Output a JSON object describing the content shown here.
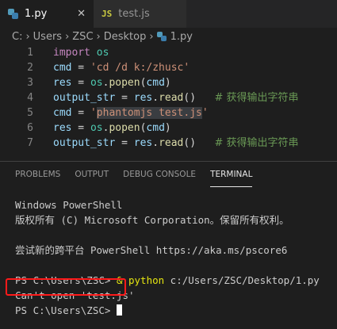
{
  "tabs": [
    {
      "label": "1.py",
      "icon": "python-file-icon",
      "active": true,
      "close": "✕"
    },
    {
      "label": "test.js",
      "icon": "js-file-icon",
      "active": false,
      "icon_text": "JS"
    }
  ],
  "breadcrumb": [
    "C:",
    "Users",
    "ZSC",
    "Desktop",
    "1.py"
  ],
  "code_lines": [
    {
      "n": "1",
      "tokens": [
        [
          "kw",
          "import"
        ],
        [
          "op",
          " "
        ],
        [
          "mod",
          "os"
        ]
      ]
    },
    {
      "n": "2",
      "tokens": [
        [
          "var",
          "cmd"
        ],
        [
          "op",
          " = "
        ],
        [
          "str",
          "'cd /d k:/zhusc'"
        ]
      ]
    },
    {
      "n": "3",
      "tokens": [
        [
          "var",
          "res"
        ],
        [
          "op",
          " = "
        ],
        [
          "mod",
          "os"
        ],
        [
          "op",
          "."
        ],
        [
          "fn",
          "popen"
        ],
        [
          "op",
          "("
        ],
        [
          "var",
          "cmd"
        ],
        [
          "op",
          ")"
        ]
      ]
    },
    {
      "n": "4",
      "tokens": [
        [
          "var",
          "output_str"
        ],
        [
          "op",
          " = "
        ],
        [
          "var",
          "res"
        ],
        [
          "op",
          "."
        ],
        [
          "fn",
          "read"
        ],
        [
          "op",
          "()   "
        ],
        [
          "cm",
          "# 获得输出字符串"
        ]
      ]
    },
    {
      "n": "5",
      "tokens": [
        [
          "var",
          "cmd"
        ],
        [
          "op",
          " = "
        ],
        [
          "str",
          "'"
        ],
        [
          "strhl",
          "phantomjs test.js"
        ],
        [
          "str",
          "'"
        ]
      ]
    },
    {
      "n": "6",
      "tokens": [
        [
          "var",
          "res"
        ],
        [
          "op",
          " = "
        ],
        [
          "mod",
          "os"
        ],
        [
          "op",
          "."
        ],
        [
          "fn",
          "popen"
        ],
        [
          "op",
          "("
        ],
        [
          "var",
          "cmd"
        ],
        [
          "op",
          ")"
        ]
      ]
    },
    {
      "n": "7",
      "tokens": [
        [
          "var",
          "output_str"
        ],
        [
          "op",
          " = "
        ],
        [
          "var",
          "res"
        ],
        [
          "op",
          "."
        ],
        [
          "fn",
          "read"
        ],
        [
          "op",
          "()   "
        ],
        [
          "cm",
          "# 获得输出字符串"
        ]
      ]
    }
  ],
  "panel_tabs": [
    {
      "label": "PROBLEMS",
      "active": false
    },
    {
      "label": "OUTPUT",
      "active": false
    },
    {
      "label": "DEBUG CONSOLE",
      "active": false
    },
    {
      "label": "TERMINAL",
      "active": true
    }
  ],
  "terminal": {
    "line1": "Windows PowerShell",
    "line2": "版权所有 (C) Microsoft Corporation。保留所有权利。",
    "line3": "",
    "line4": "尝试新的跨平台 PowerShell https://aka.ms/pscore6",
    "line5": "",
    "prompt1": "PS C:\\Users\\ZSC> ",
    "cmd_amp": "& ",
    "cmd_exe": "python",
    "cmd_arg": " c:/Users/ZSC/Desktop/1.py",
    "error": "Can't open 'test.js'",
    "prompt2": "PS C:\\Users\\ZSC> "
  },
  "colors": {
    "background": "#1e1e1e",
    "annotation_box": "#ff1a1a",
    "command_highlight": "#e5e510"
  }
}
